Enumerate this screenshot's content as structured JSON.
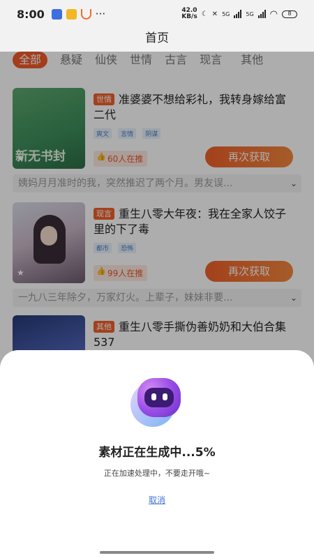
{
  "status_bar": {
    "time": "8:00",
    "more": "···",
    "net_speed_value": "42.0",
    "net_speed_unit": "KB/s",
    "network_1": "5G",
    "network_2": "5G",
    "battery": "8",
    "icons": [
      "app-notification-icon",
      "app-notification-icon",
      "app-notification-icon",
      "moon-icon",
      "vibrate-off-icon",
      "signal-icon",
      "signal-icon",
      "wifi-icon",
      "battery-icon"
    ]
  },
  "header": {
    "title": "首页"
  },
  "tabs": [
    {
      "label": "全部",
      "active": true
    },
    {
      "label": "悬疑"
    },
    {
      "label": "仙侠"
    },
    {
      "label": "世情"
    },
    {
      "label": "古言"
    },
    {
      "label": "现言"
    },
    {
      "label": "其他"
    }
  ],
  "books": [
    {
      "cover_text": "新无书封",
      "genre": "世情",
      "title": "准婆婆不想给彩礼，我转身嫁给富二代",
      "tags": [
        "爽文",
        "言情",
        "阴谋"
      ],
      "recommend": "60人在推",
      "action": "再次获取",
      "summary": "姨妈月月准时的我，突然推迟了两个月。男友误..."
    },
    {
      "genre": "现言",
      "title": "重生八零大年夜：我在全家人饺子里的下了毒",
      "tags": [
        "都市",
        "恐怖"
      ],
      "recommend": "99人在推",
      "action": "再次获取",
      "summary": "一九八三年除夕，万家灯火。上辈子，妹妹非要..."
    },
    {
      "genre": "其他",
      "title": "重生八零手撕伪善奶奶和大伯合集537"
    }
  ],
  "sheet": {
    "title": "素材正在生成中...5%",
    "subtitle": "正在加速处理中，不要走开哦~",
    "cancel": "取消",
    "progress_percent": 5
  },
  "colors": {
    "accent": "#f05a2a",
    "link": "#3d74d9",
    "overlay": "rgba(0,0,0,0.32)"
  }
}
